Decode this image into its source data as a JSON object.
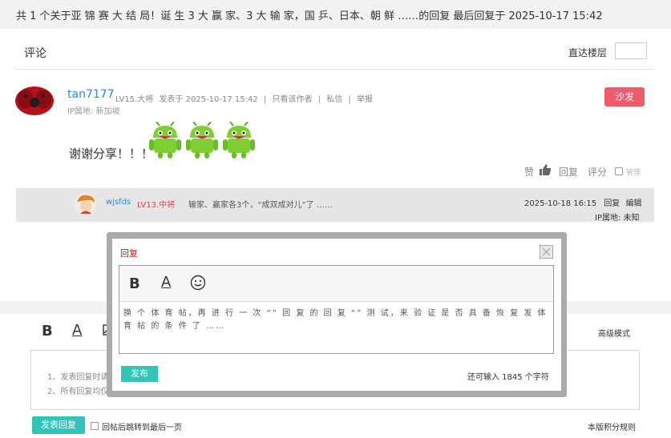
{
  "header": {
    "summary": "共 1 个关于亚 锦 赛 大 结 局！诞 生 3 大 赢 家、3 大 输 家，国 乒、日本、朝 鲜 ……的回复 最后回复于 2025-10-17 15:42"
  },
  "comments": {
    "title": "评论",
    "goto_label": "直达楼层",
    "goto_value": ""
  },
  "post": {
    "username": "tan7177",
    "level": "LV15.大将",
    "posted": "发表于 2025-10-17 15:42",
    "only_author": "只看该作者",
    "message": "私信",
    "report": "举报",
    "sep": "|",
    "ip": "IP属地: 新加坡",
    "floor": "沙发",
    "text": "谢谢分享！！！",
    "like_label": "赞",
    "reply_label": "回复",
    "rate_label": "评分",
    "manage_label": "管理"
  },
  "reply": {
    "username": "wjsfds",
    "level": "LV13.中将",
    "text": "输家、赢家各3个，“成双成对儿”了 ……",
    "time": "2025-10-18 16:15",
    "reply_label": "回复",
    "edit_label": "编辑",
    "ip": "IP属地: 未知"
  },
  "editor": {
    "bold": "B",
    "font": "A",
    "advanced": "高级模式",
    "tip1": "1、发表回复时请",
    "tip2": "2、所有回复均仅",
    "publish_reply": "发表回复",
    "jump_label": "回帖后跳转到最后一页",
    "rules": "本版积分规则"
  },
  "dialog": {
    "title": "回复",
    "bold": "B",
    "font": "A",
    "content": "换 个 体 育 帖，再 进 行 一 次 “” 回 复 的 回 复 “” 测 试，来 验 证 是 否 具 备 恢 复 发 体 育 帖 的 条 件 了 ……",
    "publish": "发布",
    "remaining": "还可输入 1845 个字符"
  },
  "colors": {
    "accent": "#34c3b8",
    "badge": "#ef5b6b",
    "link": "#2b8ad8",
    "level_red": "#e0404a",
    "dialog_title": "#c01818"
  }
}
